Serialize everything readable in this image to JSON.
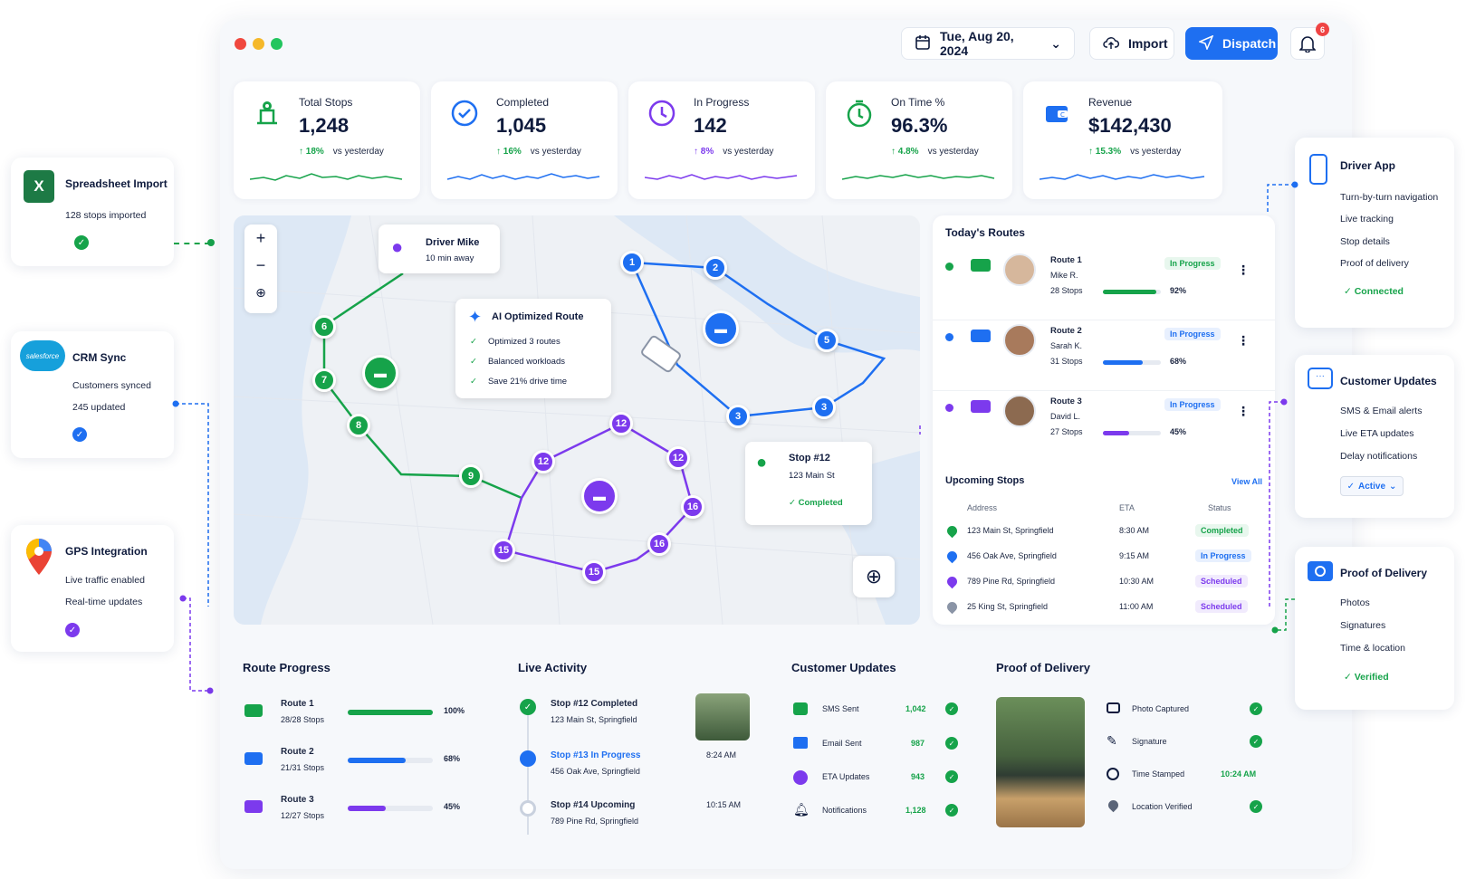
{
  "header": {
    "date": "Tue, Aug 20, 2024",
    "import_label": "Import",
    "dispatch_label": "Dispatch",
    "notifications_count": "6"
  },
  "kpis": [
    {
      "label": "Total Stops",
      "value": "1,248",
      "change": "18%",
      "vs": "vs yesterday",
      "color": "#16a34a"
    },
    {
      "label": "Completed",
      "value": "1,045",
      "change": "16%",
      "vs": "vs yesterday",
      "color": "#1e6ff1"
    },
    {
      "label": "In Progress",
      "value": "142",
      "change": "8%",
      "vs": "vs yesterday",
      "color": "#7c3aed"
    },
    {
      "label": "On Time %",
      "value": "96.3%",
      "change": "4.8%",
      "vs": "vs yesterday",
      "color": "#16a34a"
    },
    {
      "label": "Revenue",
      "value": "$142,430",
      "change": "15.3%",
      "vs": "vs yesterday",
      "color": "#1e6ff1"
    }
  ],
  "integrations": {
    "spreadsheet": {
      "title": "Spreadsheet Import",
      "line1": "128 stops imported"
    },
    "crm": {
      "title": "CRM Sync",
      "logo": "salesforce",
      "line1": "Customers synced",
      "line2": "245 updated"
    },
    "gps": {
      "title": "GPS Integration",
      "line1": "Live traffic enabled",
      "line2": "Real-time updates"
    }
  },
  "right_features": {
    "driver_app": {
      "title": "Driver App",
      "items": [
        "Turn-by-turn navigation",
        "Live tracking",
        "Stop details",
        "Proof of delivery"
      ],
      "status": "Connected"
    },
    "customer_updates": {
      "title": "Customer Updates",
      "items": [
        "SMS & Email alerts",
        "Live ETA updates",
        "Delay notifications"
      ],
      "status": "Active"
    },
    "proof": {
      "title": "Proof of Delivery",
      "items": [
        "Photos",
        "Signatures",
        "Time & location"
      ],
      "status": "Verified"
    }
  },
  "map": {
    "driver_popup": {
      "name": "Driver Mike",
      "eta": "10 min away"
    },
    "ai_popup": {
      "title": "AI Optimized Route",
      "items": [
        "Optimized 3 routes",
        "Balanced workloads",
        "Save 21% drive time"
      ]
    },
    "stop_popup": {
      "title": "Stop #12",
      "address": "123 Main St",
      "status": "Completed"
    },
    "zoom_in": "+",
    "zoom_out": "−",
    "green_stops": [
      "6",
      "7",
      "8",
      "9"
    ],
    "blue_stops": [
      "1",
      "2",
      "5",
      "3",
      "3"
    ],
    "purple_stops": [
      "12",
      "12",
      "12",
      "16",
      "16",
      "15",
      "15"
    ]
  },
  "todays_routes": {
    "title": "Today's Routes",
    "routes": [
      {
        "name": "Route 1",
        "driver": "Mike R.",
        "stops": "28 Stops",
        "status": "In Progress",
        "pct": "92%",
        "progress": 0.92,
        "color": "#16a34a"
      },
      {
        "name": "Route 2",
        "driver": "Sarah K.",
        "stops": "31 Stops",
        "status": "In Progress",
        "pct": "68%",
        "progress": 0.68,
        "color": "#1e6ff1"
      },
      {
        "name": "Route 3",
        "driver": "David L.",
        "stops": "27 Stops",
        "status": "In Progress",
        "pct": "45%",
        "progress": 0.45,
        "color": "#7c3aed"
      }
    ]
  },
  "upcoming": {
    "title": "Upcoming Stops",
    "view_all": "View All",
    "columns": [
      "Address",
      "ETA",
      "Status"
    ],
    "rows": [
      {
        "address": "123 Main St, Springfield",
        "eta": "8:30 AM",
        "status": "Completed",
        "color": "#16a34a"
      },
      {
        "address": "456 Oak Ave, Springfield",
        "eta": "9:15 AM",
        "status": "In Progress",
        "color": "#1e6ff1"
      },
      {
        "address": "789 Pine Rd, Springfield",
        "eta": "10:30 AM",
        "status": "Scheduled",
        "color": "#7c3aed"
      },
      {
        "address": "25 King St, Springfield",
        "eta": "11:00 AM",
        "status": "Scheduled",
        "color": "#8a94a6"
      }
    ]
  },
  "route_progress": {
    "title": "Route Progress",
    "rows": [
      {
        "name": "Route 1",
        "sub": "28/28 Stops",
        "pct": "100%",
        "progress": 1.0,
        "color": "#16a34a"
      },
      {
        "name": "Route 2",
        "sub": "21/31 Stops",
        "pct": "68%",
        "progress": 0.68,
        "color": "#1e6ff1"
      },
      {
        "name": "Route 3",
        "sub": "12/27 Stops",
        "pct": "45%",
        "progress": 0.45,
        "color": "#7c3aed"
      }
    ]
  },
  "live_activity": {
    "title": "Live Activity",
    "items": [
      {
        "title": "Stop #12 Completed",
        "address": "123 Main St, Springfield",
        "time": ""
      },
      {
        "title": "Stop #13 In Progress",
        "address": "456 Oak Ave, Springfield",
        "time": "8:24 AM"
      },
      {
        "title": "Stop #14 Upcoming",
        "address": "789 Pine Rd, Springfield",
        "time": "10:15 AM"
      }
    ]
  },
  "customer_updates_panel": {
    "title": "Customer Updates",
    "rows": [
      {
        "label": "SMS Sent",
        "value": "1,042"
      },
      {
        "label": "Email Sent",
        "value": "987"
      },
      {
        "label": "ETA Updates",
        "value": "943"
      },
      {
        "label": "Notifications",
        "value": "1,128"
      }
    ]
  },
  "proof_panel": {
    "title": "Proof of Delivery",
    "rows": [
      {
        "label": "Photo Captured",
        "value": ""
      },
      {
        "label": "Signature",
        "value": ""
      },
      {
        "label": "Time Stamped",
        "value": "10:24 AM"
      },
      {
        "label": "Location Verified",
        "value": ""
      }
    ]
  }
}
